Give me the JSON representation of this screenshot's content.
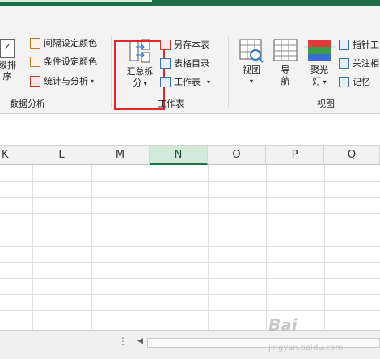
{
  "ribbon": {
    "left_partial": {
      "top": "Z",
      "label1": "级排",
      "label2": "序"
    },
    "data_analysis": {
      "items": [
        "间隔设定颜色",
        "条件设定颜色",
        "统计与分析"
      ],
      "group_label": "数据分析"
    },
    "workbook": {
      "big_button": {
        "line1": "汇总拆",
        "line2": "分"
      },
      "items": [
        "另存本表",
        "表格目录",
        "工作表"
      ],
      "group_label": "工作表"
    },
    "view": {
      "buttons": [
        {
          "line1": "视图",
          "line2": ""
        },
        {
          "line1": "导",
          "line2": "航"
        },
        {
          "line1": "聚光",
          "line2": "灯"
        }
      ],
      "items": [
        "指针工",
        "关注相",
        "记忆"
      ],
      "group_label": "视图"
    }
  },
  "sheet": {
    "columns": [
      "K",
      "L",
      "M",
      "N",
      "O",
      "P",
      "Q"
    ],
    "active_column": "N"
  },
  "watermark": {
    "text": "Bai",
    "sub": "jingyan.baidu.com"
  }
}
